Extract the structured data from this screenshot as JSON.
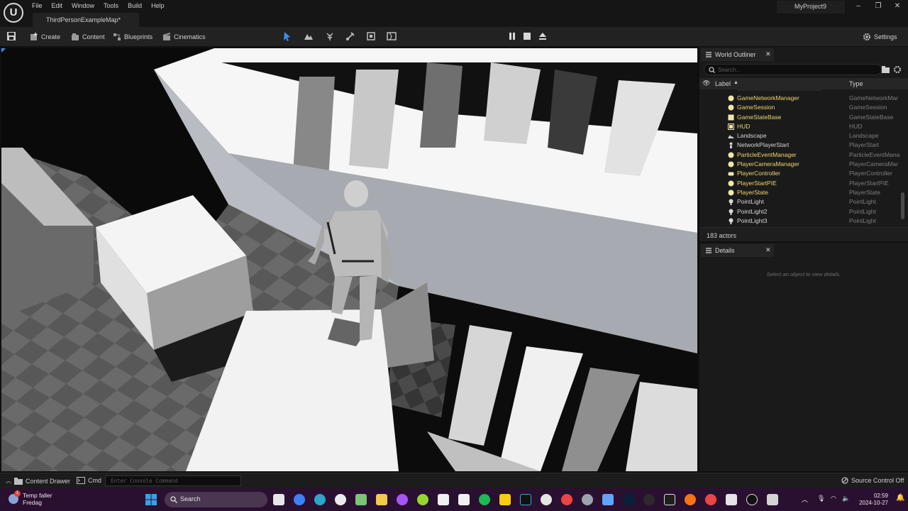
{
  "menu": [
    "File",
    "Edit",
    "Window",
    "Tools",
    "Build",
    "Help"
  ],
  "document_tab": "ThirdPersonExampleMap*",
  "project_name": "MyProject9",
  "toolbar": {
    "create": "Create",
    "content": "Content",
    "blueprints": "Blueprints",
    "cinematics": "Cinematics",
    "settings": "Settings"
  },
  "outliner": {
    "title": "World Outliner",
    "search_placeholder": "Search...",
    "col_label": "Label",
    "col_type": "Type",
    "rows": [
      {
        "label": "GameNetworkManager",
        "type": "GameNetworkMar",
        "icon": "sphere-icon",
        "color": "gold"
      },
      {
        "label": "GameSession",
        "type": "GameSession",
        "icon": "sphere-icon",
        "color": "gold"
      },
      {
        "label": "GameStateBase",
        "type": "GameStateBase",
        "icon": "square-icon",
        "color": "gold"
      },
      {
        "label": "HUD",
        "type": "HUD",
        "icon": "hud-icon",
        "color": "gold"
      },
      {
        "label": "Landscape",
        "type": "Landscape",
        "icon": "landscape-icon",
        "color": "white"
      },
      {
        "label": "NetworkPlayerStart",
        "type": "PlayerStart",
        "icon": "player-start-icon",
        "color": "white"
      },
      {
        "label": "ParticleEventManager",
        "type": "ParticleEventMana",
        "icon": "sphere-icon",
        "color": "gold"
      },
      {
        "label": "PlayerCameraManager",
        "type": "PlayerCameraMar",
        "icon": "sphere-icon",
        "color": "gold"
      },
      {
        "label": "PlayerController",
        "type": "PlayerController",
        "icon": "gamepad-icon",
        "color": "gold"
      },
      {
        "label": "PlayerStartPIE",
        "type": "PlayerStartPIE",
        "icon": "sphere-icon",
        "color": "gold"
      },
      {
        "label": "PlayerState",
        "type": "PlayerState",
        "icon": "sphere-icon",
        "color": "gold"
      },
      {
        "label": "PointLight",
        "type": "PointLight",
        "icon": "bulb-icon",
        "color": "white"
      },
      {
        "label": "PointLight2",
        "type": "PointLight",
        "icon": "bulb-icon",
        "color": "white"
      },
      {
        "label": "PointLight3",
        "type": "PointLight",
        "icon": "bulb-icon",
        "color": "white"
      }
    ],
    "actor_count": "183 actors"
  },
  "details": {
    "title": "Details",
    "empty_text": "Select an object to view details."
  },
  "statusbar": {
    "content_drawer": "Content Drawer",
    "cmd": "Cmd",
    "console_placeholder": "Enter Console Command",
    "source_control": "Source Control Off"
  },
  "taskbar": {
    "weather_title": "Temp faller",
    "weather_sub": "Fredag",
    "weather_badge": "1",
    "search": "Search",
    "time": "02:59",
    "date": "2024-10-27"
  },
  "colors": {
    "gold": "#f2d66e",
    "accent_blue": "#3a8ee6",
    "taskbar": "#2a1030"
  }
}
